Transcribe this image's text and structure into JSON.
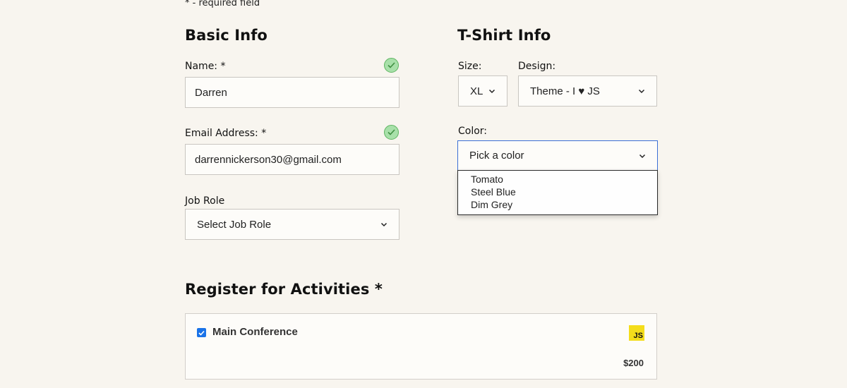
{
  "form": {
    "required_note": "* - required field",
    "basic_info": {
      "title": "Basic Info",
      "name_label": "Name: *",
      "name_value": "Darren",
      "email_label": "Email Address: *",
      "email_value": "darrennickerson30@gmail.com",
      "job_role_label": "Job Role",
      "job_role_value": "Select Job Role"
    },
    "tshirt_info": {
      "title": "T-Shirt Info",
      "size_label": "Size:",
      "size_value": "XL",
      "design_label": "Design:",
      "design_value": "Theme - I ♥ JS",
      "color_label": "Color:",
      "color_value": "Pick a color",
      "color_options": [
        "Tomato",
        "Steel Blue",
        "Dim Grey"
      ]
    },
    "activities": {
      "title": "Register for Activities *",
      "items": [
        {
          "label": "Main Conference",
          "badge": "JS",
          "price": "$200",
          "checked": true
        }
      ]
    }
  },
  "colors": {
    "background": "#f8f5ef",
    "valid_green": "#5fb562",
    "focus_blue": "#3b6fd6",
    "checkbox_blue": "#1a73e8",
    "js_yellow": "#f4dd1b"
  },
  "icons": [
    "checkmark-icon",
    "chevron-down-icon",
    "js-logo-icon"
  ]
}
